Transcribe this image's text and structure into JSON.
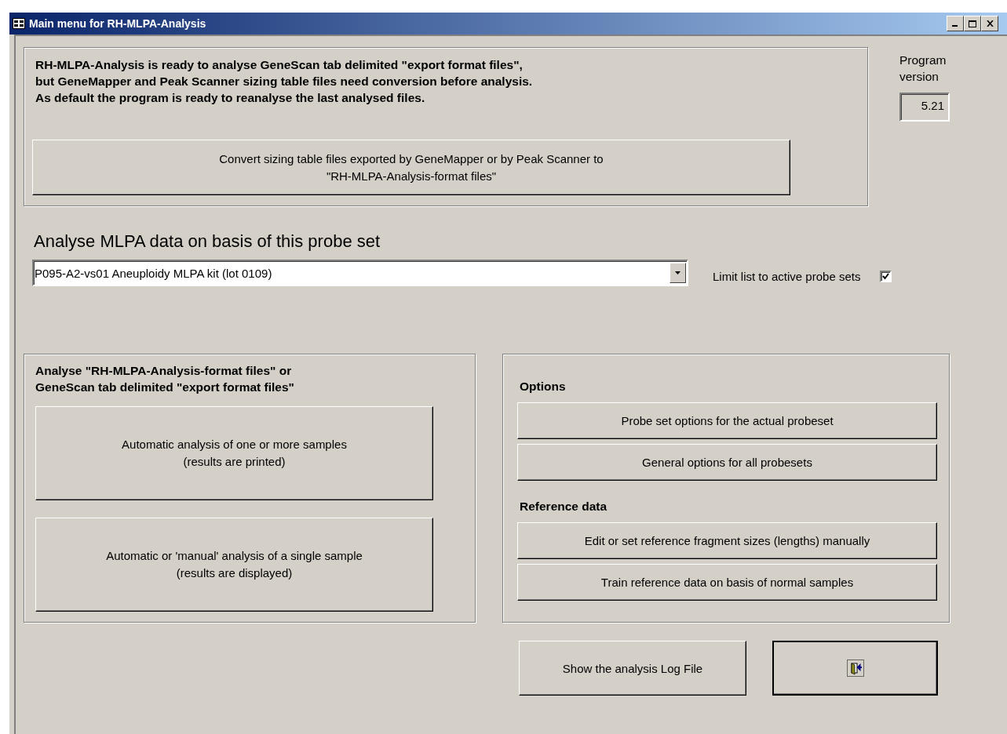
{
  "window": {
    "title": "Main menu for RH-MLPA-Analysis"
  },
  "intro": {
    "text": "RH-MLPA-Analysis is ready to analyse GeneScan tab delimited \"export format files\",\nbut GeneMapper and Peak Scanner sizing table files need conversion before analysis.\nAs default the program is ready to reanalyse the last analysed files.",
    "convert_button": "Convert sizing table files exported by GeneMapper or by Peak Scanner  to\n\"RH-MLPA-Analysis-format files\""
  },
  "version": {
    "label": "Program\nversion",
    "value": "5.21"
  },
  "probe_set": {
    "heading": "Analyse MLPA data on basis of this probe set",
    "value": "P095-A2-vs01 Aneuploidy MLPA kit (lot 0109)",
    "limit_label": "Limit list to active probe sets",
    "limit_checked": true
  },
  "analyse": {
    "heading": "Analyse \"RH-MLPA-Analysis-format files\" or\nGeneScan tab delimited \"export format files\"",
    "buttons": [
      "Automatic analysis of one or more samples\n(results are printed)",
      "Automatic or 'manual' analysis of a single sample\n(results are displayed)"
    ]
  },
  "options": {
    "sections": [
      {
        "heading": "Options",
        "buttons": [
          "Probe set options for the actual probeset",
          "General options for all probesets"
        ]
      },
      {
        "heading": "Reference data",
        "buttons": [
          "Edit or set reference fragment sizes (lengths) manually",
          "Train reference data on basis of normal samples"
        ]
      }
    ]
  },
  "bottom": {
    "log_button": "Show the analysis Log File"
  }
}
